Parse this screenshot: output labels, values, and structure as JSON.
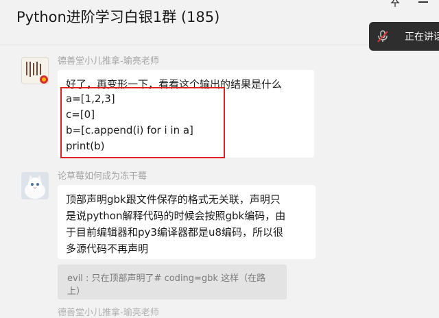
{
  "header": {
    "title": "Python进阶学习白银1群 (185)",
    "voice_banner_label": "正在讲话"
  },
  "messages": [
    {
      "sender": "德善堂小儿推拿-瑜亮老师",
      "lines": [
        "好了，再变形一下，看看这个输出的结果是什么",
        "a=[1,2,3]",
        "c=[0]",
        "b=[c.append(i) for i in a]",
        "print(b)"
      ]
    },
    {
      "sender": "论草莓如何成为冻干莓",
      "lines": [
        "顶部声明gbk跟文件保存的格式无关联，声明只",
        "是说python解释代码的时候会按照gbk编码，由",
        "于目前编辑器和py3编译器都是u8编码，所以很",
        "多源代码不再声明"
      ],
      "quote_lines": [
        "evil : 只在顶部声明了# coding=gbk 这样（在路",
        "上）"
      ]
    }
  ],
  "partial_sender": "德善堂小儿推拿-瑜亮老师",
  "colors": {
    "highlight_border": "#e02020",
    "bubble_bg": "#ffffff",
    "page_bg": "#f2f2f2",
    "sender_text": "#a3a3a3"
  },
  "icons": [
    "pin-icon",
    "minimize-icon",
    "mic-muted-icon"
  ]
}
